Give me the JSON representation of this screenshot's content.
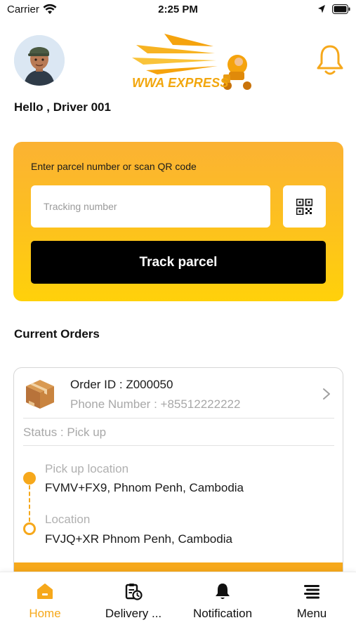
{
  "status_bar": {
    "carrier": "Carrier",
    "time": "2:25 PM"
  },
  "header": {
    "logo_text": "WWA EXPRESS",
    "greeting": "Hello , Driver 001"
  },
  "track": {
    "prompt": "Enter parcel number or scan QR code",
    "placeholder": "Tracking number",
    "value": "",
    "button_label": "Track parcel"
  },
  "current_orders": {
    "title": "Current Orders",
    "orders": [
      {
        "order_id": "Order ID  : Z000050",
        "phone": "Phone Number  : +85512222222",
        "status": "Status  : Pick up",
        "pickup_label": "Pick up location",
        "pickup_address": "FVMV+FX9, Phnom Penh, Cambodia",
        "location_label": "Location",
        "location_address": "FVJQ+XR Phnom Penh, Cambodia"
      }
    ]
  },
  "nav": {
    "items": [
      {
        "label": "Home",
        "icon": "home-icon",
        "active": true
      },
      {
        "label": "Delivery ...",
        "icon": "delivery-icon",
        "active": false
      },
      {
        "label": "Notification",
        "icon": "bell-icon",
        "active": false
      },
      {
        "label": "Menu",
        "icon": "menu-icon",
        "active": false
      }
    ]
  },
  "colors": {
    "accent": "#f6a81b",
    "card_gradient_top": "#fbb233",
    "card_gradient_bottom": "#ffd10a",
    "button": "#000000"
  }
}
